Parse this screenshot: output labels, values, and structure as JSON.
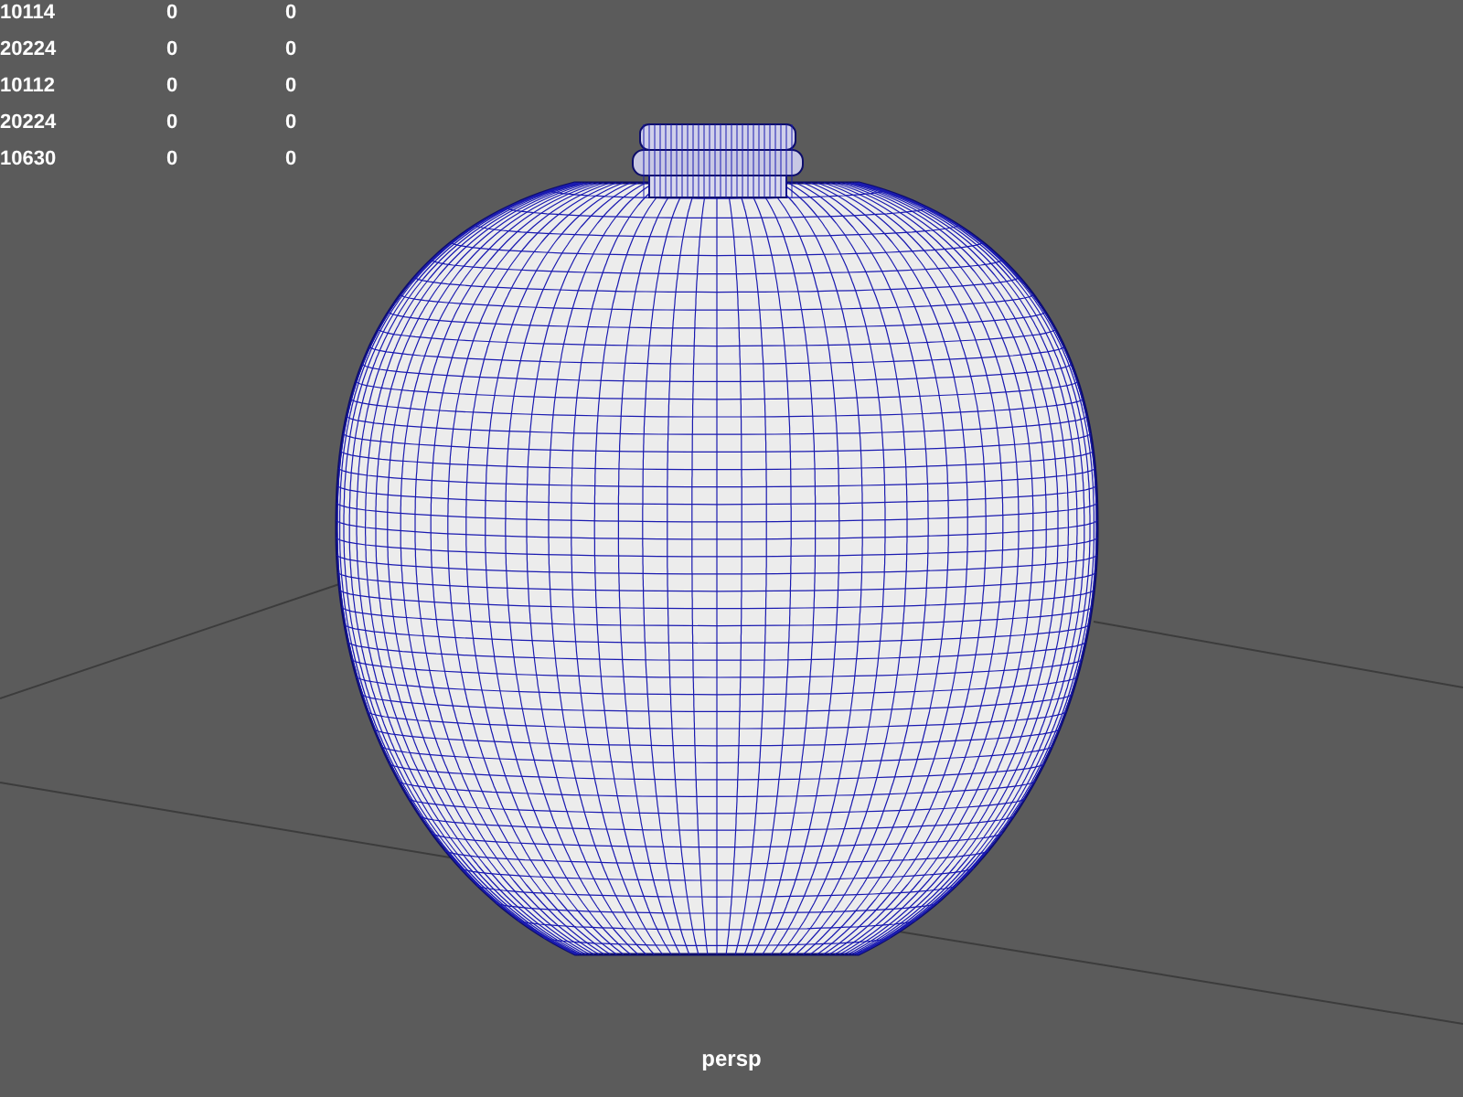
{
  "stats": [
    {
      "column_1": "10114",
      "column_2": "0",
      "column_3": "0"
    },
    {
      "column_1": "20224",
      "column_2": "0",
      "column_3": "0"
    },
    {
      "column_1": "10112",
      "column_2": "0",
      "column_3": "0"
    },
    {
      "column_1": "20224",
      "column_2": "0",
      "column_3": "0"
    },
    {
      "column_1": "10630",
      "column_2": "0",
      "column_3": "0"
    }
  ],
  "camera_label": "persp"
}
